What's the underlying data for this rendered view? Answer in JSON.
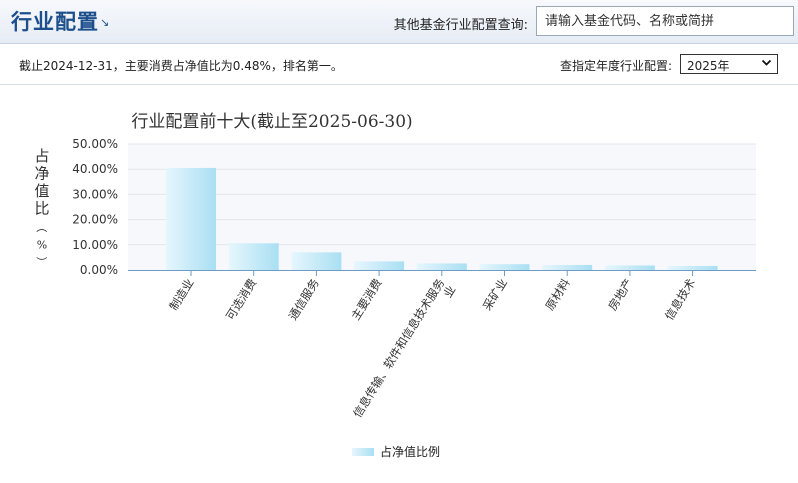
{
  "header": {
    "title": "行业配置",
    "arrow_icon": "↘",
    "search_label": "其他基金行业配置查询:",
    "search_placeholder": "请输入基金代码、名称或简拼"
  },
  "info": {
    "summary": "截止2024-12-31，主要消费占净值比为0.48%，排名第一。",
    "year_label": "查指定年度行业配置:",
    "year_selected": "2025年"
  },
  "colors": {
    "bar_light": "#e6f6fd",
    "bar_dark": "#a9dff3",
    "plot_bg": "#f7f8fb",
    "grid": "#e3e6ec",
    "axis": "#6e9bc3"
  },
  "chart_data": {
    "type": "bar",
    "title": "行业配置前十大(截止至2025-06-30)",
    "ylabel": "占净值比（%）",
    "xlabel": "",
    "categories": [
      "制造业",
      "可选消费",
      "通信服务",
      "主要消费",
      "信息传输、软件和信息技术服务业",
      "采矿业",
      "原材料",
      "房地产",
      "信息技术"
    ],
    "series": [
      {
        "name": "占净值比例",
        "values": [
          40.5,
          10.6,
          7.0,
          3.4,
          2.6,
          2.3,
          2.0,
          1.8,
          1.6
        ]
      }
    ],
    "ylim": [
      0,
      50
    ],
    "yticks": [
      0,
      10,
      20,
      30,
      40,
      50
    ],
    "ytick_labels": [
      "0.00%",
      "10.00%",
      "20.00%",
      "30.00%",
      "40.00%",
      "50.00%"
    ],
    "grid": true,
    "legend": "bottom-center"
  }
}
